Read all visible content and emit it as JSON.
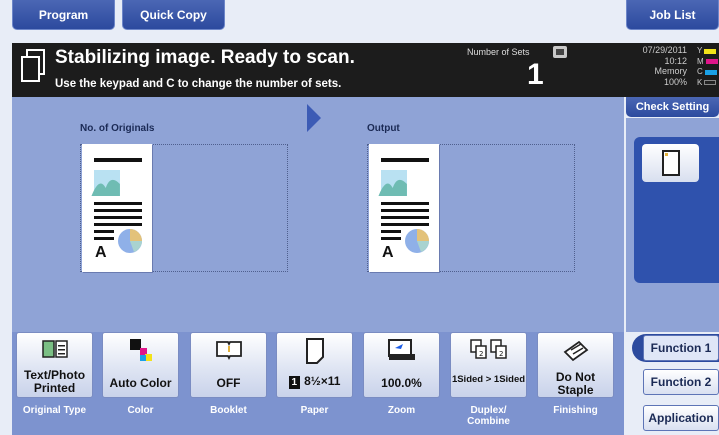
{
  "top_tabs": {
    "program": "Program",
    "quick_copy": "Quick Copy",
    "job_list": "Job List"
  },
  "status": {
    "message": "Stabilizing image. Ready to scan.",
    "hint": "Use the keypad and C to change the number of sets.",
    "sets_label": "Number of Sets",
    "sets_value": "1",
    "date": "07/29/2011",
    "time": "10:12",
    "memory_label": "Memory",
    "memory_value": "100%",
    "toner": [
      {
        "letter": "Y",
        "color": "#f2e21a"
      },
      {
        "letter": "M",
        "color": "#e0158a"
      },
      {
        "letter": "C",
        "color": "#1aa0e6"
      },
      {
        "letter": "K",
        "color": "#222222"
      }
    ]
  },
  "check_setting": "Check Setting",
  "preview": {
    "originals_label": "No. of Originals",
    "output_label": "Output",
    "page_letter": "A"
  },
  "functions": [
    {
      "value": "Text/Photo Printed",
      "label": "Original Type",
      "icon": "original-type-icon"
    },
    {
      "value": "Auto Color",
      "label": "Color",
      "icon": "color-icon"
    },
    {
      "value": "OFF",
      "label": "Booklet",
      "icon": "booklet-icon"
    },
    {
      "value": "8½×11",
      "label": "Paper",
      "icon": "paper-icon",
      "tray": "1"
    },
    {
      "value": "100.0%",
      "label": "Zoom",
      "icon": "zoom-icon"
    },
    {
      "value": "1Sided > 1Sided",
      "label": "Duplex/ Combine",
      "icon": "duplex-icon"
    },
    {
      "value": "Do Not Staple",
      "label": "Finishing",
      "icon": "finishing-icon"
    }
  ],
  "right_buttons": {
    "function1": "Function 1",
    "function2": "Function 2",
    "application": "Application"
  }
}
